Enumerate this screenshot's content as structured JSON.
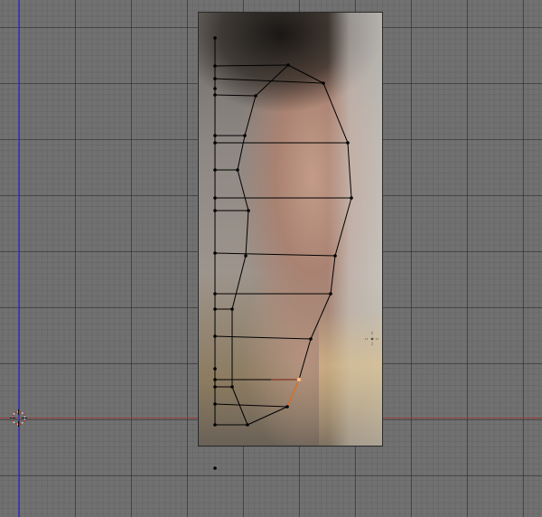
{
  "viewport": {
    "mode": "edit",
    "grid_visible": true
  },
  "reference_image": {
    "subject": "ear-photo"
  },
  "colors": {
    "background": "#717171",
    "grid_major": "#3a3a3a",
    "axis_x": "#9a3a3a",
    "axis_y": "#4040a8",
    "edge": "#000000",
    "selected_edge": "#ff7a20",
    "vertex": "#000000",
    "selected_vertex": "#ffc080"
  },
  "icons": {
    "cursor": "3d-cursor-icon",
    "pivot": "pivot-point-icon"
  }
}
